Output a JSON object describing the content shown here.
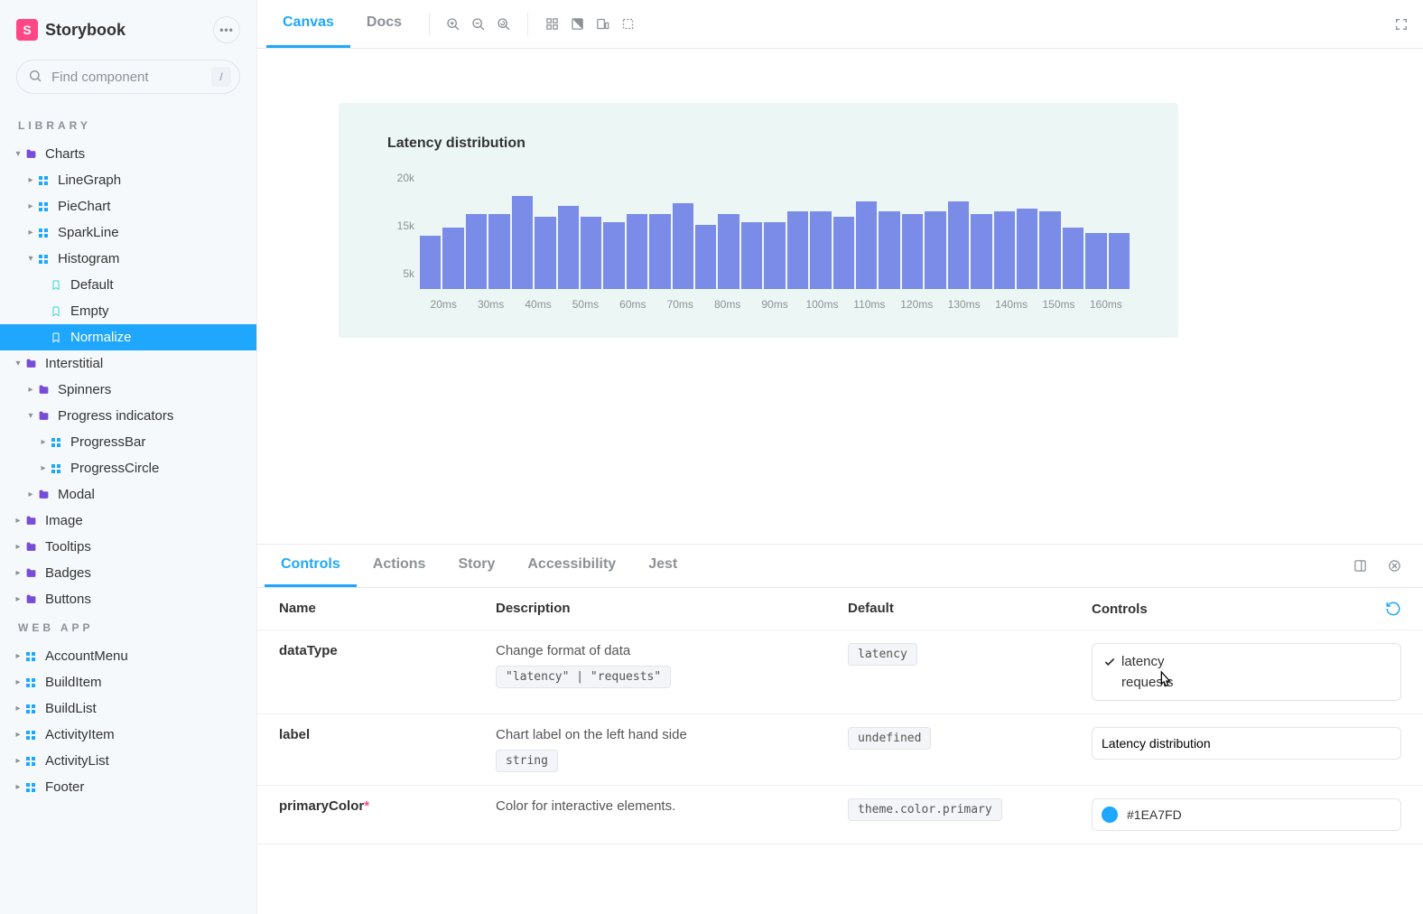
{
  "brand": {
    "title": "Storybook",
    "logo_letter": "S"
  },
  "search": {
    "placeholder": "Find component",
    "shortcut": "/"
  },
  "sidebar": {
    "sections": [
      {
        "label": "LIBRARY",
        "items": [
          {
            "label": "Charts",
            "kind": "folder",
            "indent": 0,
            "expanded": true
          },
          {
            "label": "LineGraph",
            "kind": "component",
            "indent": 1
          },
          {
            "label": "PieChart",
            "kind": "component",
            "indent": 1
          },
          {
            "label": "SparkLine",
            "kind": "component",
            "indent": 1
          },
          {
            "label": "Histogram",
            "kind": "component",
            "indent": 1,
            "expanded": true
          },
          {
            "label": "Default",
            "kind": "story",
            "indent": 2
          },
          {
            "label": "Empty",
            "kind": "story",
            "indent": 2
          },
          {
            "label": "Normalize",
            "kind": "story",
            "indent": 2,
            "selected": true
          },
          {
            "label": "Interstitial",
            "kind": "folder",
            "indent": 0,
            "expanded": true
          },
          {
            "label": "Spinners",
            "kind": "folder",
            "indent": 1
          },
          {
            "label": "Progress indicators",
            "kind": "folder",
            "indent": 1,
            "expanded": true
          },
          {
            "label": "ProgressBar",
            "kind": "component",
            "indent": 2
          },
          {
            "label": "ProgressCircle",
            "kind": "component",
            "indent": 2
          },
          {
            "label": "Modal",
            "kind": "folder",
            "indent": 1
          },
          {
            "label": "Image",
            "kind": "folder",
            "indent": 0
          },
          {
            "label": "Tooltips",
            "kind": "folder",
            "indent": 0
          },
          {
            "label": "Badges",
            "kind": "folder",
            "indent": 0
          },
          {
            "label": "Buttons",
            "kind": "folder",
            "indent": 0
          }
        ]
      },
      {
        "label": "WEB APP",
        "items": [
          {
            "label": "AccountMenu",
            "kind": "component",
            "indent": 0
          },
          {
            "label": "BuildItem",
            "kind": "component",
            "indent": 0
          },
          {
            "label": "BuildList",
            "kind": "component",
            "indent": 0
          },
          {
            "label": "ActivityItem",
            "kind": "component",
            "indent": 0
          },
          {
            "label": "ActivityList",
            "kind": "component",
            "indent": 0
          },
          {
            "label": "Footer",
            "kind": "component",
            "indent": 0
          }
        ]
      }
    ]
  },
  "toolbar": {
    "tabs": [
      {
        "label": "Canvas",
        "active": true
      },
      {
        "label": "Docs",
        "active": false
      }
    ]
  },
  "addons": {
    "tabs": [
      {
        "label": "Controls",
        "active": true
      },
      {
        "label": "Actions"
      },
      {
        "label": "Story"
      },
      {
        "label": "Accessibility"
      },
      {
        "label": "Jest"
      }
    ],
    "headers": {
      "name": "Name",
      "description": "Description",
      "default": "Default",
      "controls": "Controls"
    },
    "rows": [
      {
        "name": "dataType",
        "description": "Change format of data",
        "type_signature": "\"latency\" | \"requests\"",
        "default": "latency",
        "control": {
          "kind": "radio",
          "options": [
            "latency",
            "requests"
          ],
          "selected": "latency"
        }
      },
      {
        "name": "label",
        "description": "Chart label on the left hand side",
        "type_signature": "string",
        "default": "undefined",
        "control": {
          "kind": "text",
          "value": "Latency distribution"
        }
      },
      {
        "name": "primaryColor",
        "required": true,
        "description": "Color for interactive elements.",
        "default": "theme.color.primary",
        "control": {
          "kind": "color",
          "value": "#1EA7FD"
        }
      }
    ]
  },
  "chart_data": {
    "type": "bar",
    "title": "Latency distribution",
    "y_ticks": [
      "20k",
      "15k",
      "5k"
    ],
    "x_ticks": [
      "20ms",
      "30ms",
      "40ms",
      "50ms",
      "60ms",
      "70ms",
      "80ms",
      "90ms",
      "100ms",
      "110ms",
      "120ms",
      "130ms",
      "140ms",
      "150ms",
      "160ms"
    ],
    "ylim": [
      0,
      22000
    ],
    "values": [
      10000,
      11500,
      14000,
      14000,
      17500,
      13500,
      15500,
      13500,
      12500,
      14000,
      14000,
      16000,
      12000,
      14000,
      12500,
      12500,
      14500,
      14500,
      13500,
      16500,
      14500,
      14000,
      14500,
      16500,
      14000,
      14500,
      15000,
      14500,
      11500,
      10500,
      10500
    ]
  },
  "colors": {
    "accent": "#1ea7fd",
    "bar": "#7a8ce8"
  }
}
